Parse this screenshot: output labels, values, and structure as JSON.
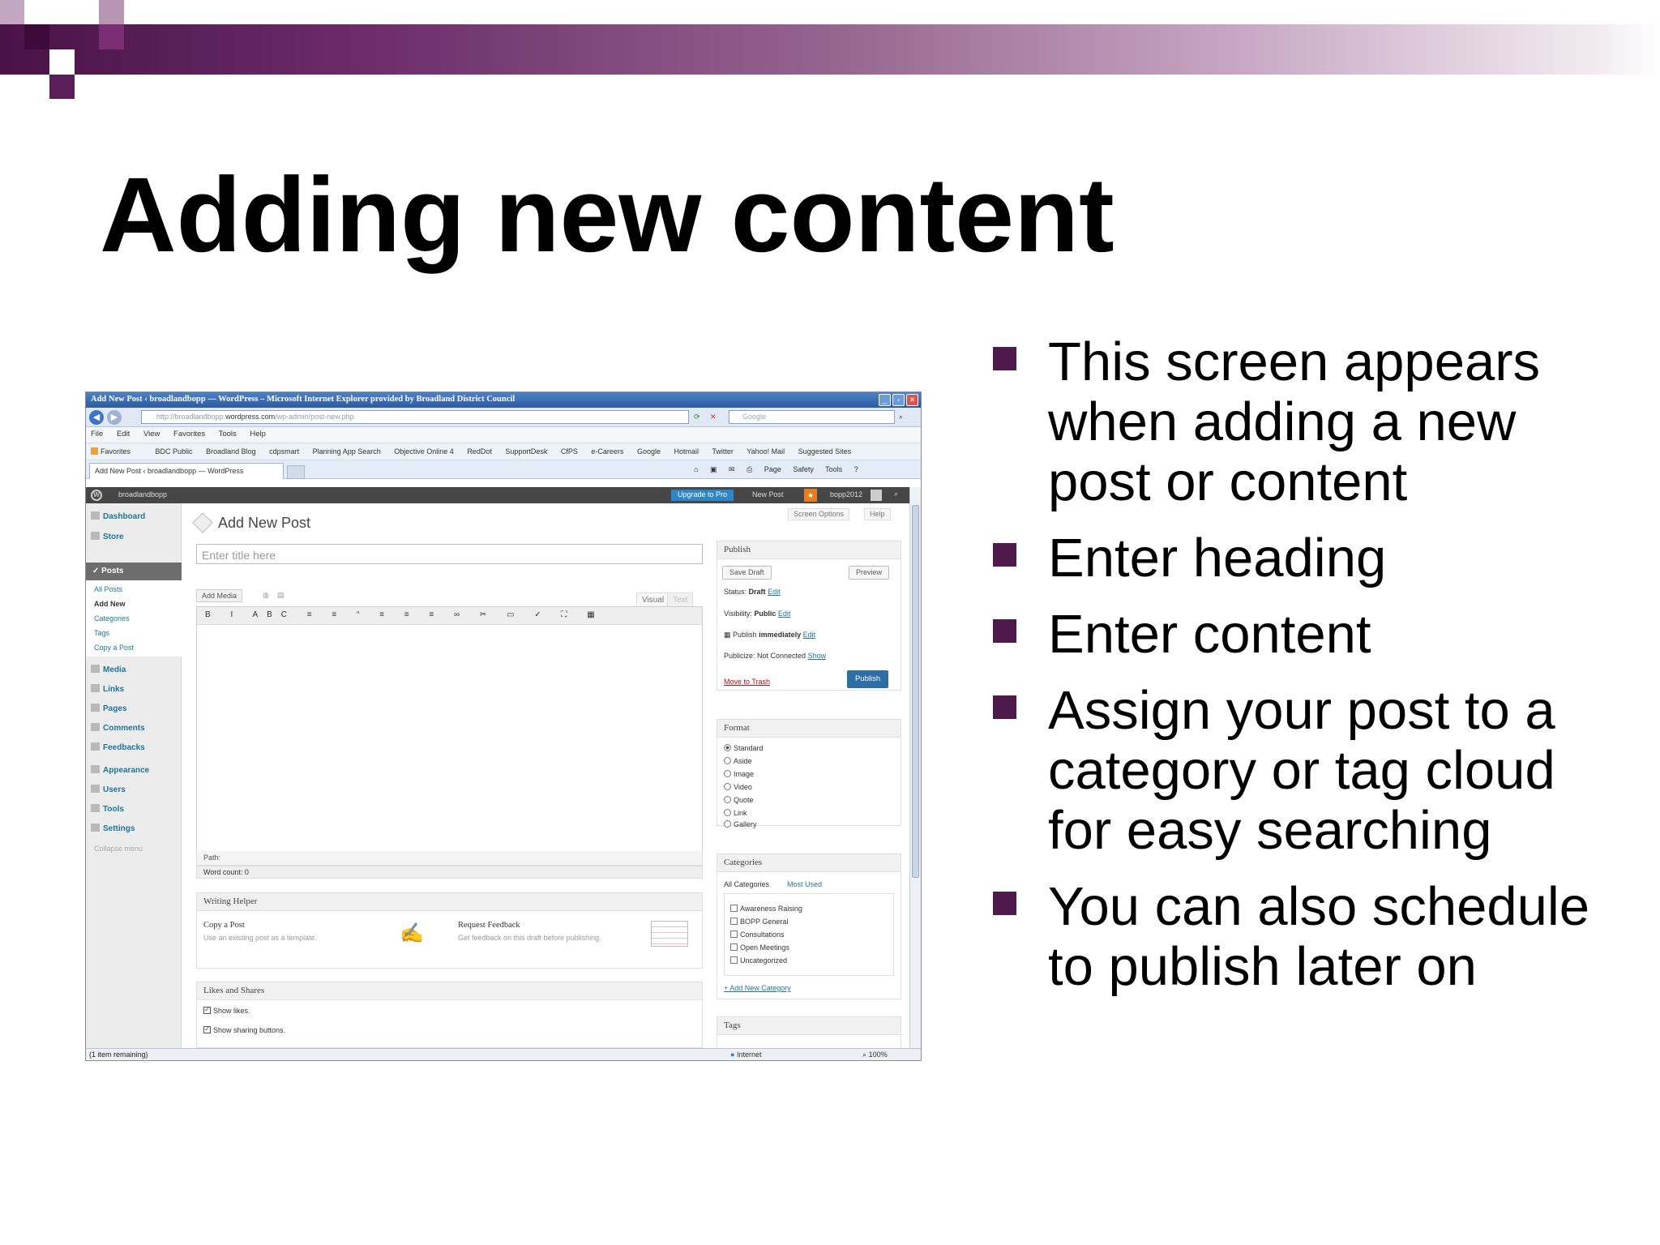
{
  "slide": {
    "title": "Adding new content",
    "bullets": [
      "This screen appears when adding a new post or content",
      "Enter heading",
      "Enter content",
      "Assign your post to a category or tag cloud for easy searching",
      "You can also schedule to publish later on"
    ],
    "colors": {
      "accent": "#4e1a4c",
      "bar_start": "#4a1248",
      "bar_end": "#ffffff"
    }
  },
  "browser": {
    "window_title": "Add New Post ‹ broadlandbopp — WordPress – Microsoft Internet Explorer provided by Broadland District Council",
    "address_prefix": "http://broadlandbopp.",
    "address_domain": "wordpress.com",
    "address_path": "/wp-admin/post-new.php",
    "search_placeholder": "Google",
    "menu": [
      "File",
      "Edit",
      "View",
      "Favorites",
      "Tools",
      "Help"
    ],
    "favorites_label": "Favorites",
    "favorites": [
      "BDC Public",
      "Broadland Blog",
      "cdpsmart",
      "Planning App Search",
      "Objective Online 4",
      "RedDot",
      "SupportDesk",
      "CfPS",
      "e-Careers",
      "Google",
      "Hotmail",
      "Twitter",
      "Yahoo! Mail",
      "Suggested Sites"
    ],
    "tab_title": "Add New Post ‹ broadlandbopp — WordPress",
    "commands": [
      "Page",
      "Safety",
      "Tools"
    ],
    "status_left": "(1 item remaining)",
    "status_zone": "Internet",
    "zoom": "100%"
  },
  "wp": {
    "site_name": "broadlandbopp",
    "upgrade_label": "Upgrade to Pro",
    "new_post_label": "New Post",
    "user_name": "bopp2012",
    "screen_options": "Screen Options",
    "help": "Help",
    "menu": {
      "dashboard": "Dashboard",
      "store": "Store",
      "posts": "Posts",
      "sub": [
        "All Posts",
        "Add New",
        "Categories",
        "Tags",
        "Copy a Post"
      ],
      "media": "Media",
      "links": "Links",
      "pages": "Pages",
      "comments": "Comments",
      "feedbacks": "Feedbacks",
      "appearance": "Appearance",
      "users": "Users",
      "tools": "Tools",
      "settings": "Settings",
      "collapse": "Collapse menu"
    },
    "page_title": "Add New Post",
    "title_placeholder": "Enter title here",
    "add_media": "Add Media",
    "tab_visual": "Visual",
    "tab_text": "Text",
    "toolbar_glyphs": "B I ABC ≡ ≡ “ ≡ ≡ ≡ ∞ ✂ ▭ ✓ ⛶ ▦",
    "path_label": "Path:",
    "word_count": "Word count: 0",
    "publish": {
      "heading": "Publish",
      "save_draft": "Save Draft",
      "preview": "Preview",
      "status_label": "Status:",
      "status_value": "Draft",
      "visibility_label": "Visibility:",
      "visibility_value": "Public",
      "publish_label": "Publish",
      "publish_value": "immediately",
      "edit": "Edit",
      "publicize_label": "Publicize: Not Connected",
      "show": "Show",
      "trash": "Move to Trash",
      "publish_button": "Publish"
    },
    "format": {
      "heading": "Format",
      "options": [
        "Standard",
        "Aside",
        "Image",
        "Video",
        "Quote",
        "Link",
        "Gallery"
      ],
      "selected": "Standard"
    },
    "categories": {
      "heading": "Categories",
      "tab_all": "All Categories",
      "tab_most": "Most Used",
      "items": [
        "Awareness Raising",
        "BOPP General",
        "Consultations",
        "Open Meetings",
        "Uncategorized"
      ],
      "add_new": "+ Add New Category"
    },
    "tags_heading": "Tags",
    "writing_helper": {
      "heading": "Writing Helper",
      "copy_title": "Copy a Post",
      "copy_desc": "Use an existing post as a template.",
      "feedback_title": "Request Feedback",
      "feedback_desc": "Get feedback on this draft before publishing."
    },
    "likes": {
      "heading": "Likes and Shares",
      "show_likes": "Show likes.",
      "show_sharing": "Show sharing buttons."
    }
  }
}
